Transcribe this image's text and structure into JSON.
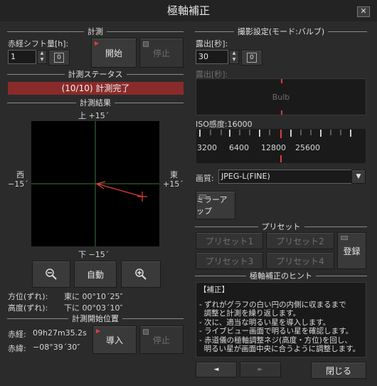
{
  "window": {
    "title": "極軸補正",
    "close": "✕"
  },
  "measure": {
    "section": "計測",
    "shift_label": "赤経シフト量[h]:",
    "shift_value": "1",
    "zero_button": "0",
    "start_button": "開始",
    "stop_button": "停止"
  },
  "status": {
    "section": "計測ステータス",
    "text": "(10/10) 計測完了"
  },
  "result": {
    "section": "計測結果",
    "north": "上 +15´",
    "south": "下 −15´",
    "west_name": "西",
    "west_value": "−15´",
    "east_name": "東",
    "east_value": "+15´",
    "zoom_out": "zoom-out",
    "auto": "自動",
    "zoom_in": "zoom-in",
    "azimuth_label": "方位(ずれ):",
    "azimuth_value": "東に 00°10´25″",
    "altitude_label": "高度(ずれ):",
    "altitude_value": "下に 00°03´10″"
  },
  "start_position": {
    "section": "計測開始位置",
    "ra_label": "赤経:",
    "ra_value": "09h27m35.2s",
    "dec_label": "赤緯:",
    "dec_value": "−08°39´30″",
    "import_button": "導入",
    "stop_button": "停止"
  },
  "capture": {
    "section": "撮影設定(モード:バルブ)",
    "exposure_label": "露出[秒]:",
    "exposure_value": "30",
    "zero_button": "0",
    "exposure_label2": "露出[秒]:",
    "bulb_text": "Bulb",
    "iso_label": "ISO感度:16000",
    "iso_ticks": [
      "3200",
      "6400",
      "12800",
      "25600"
    ],
    "quality_label": "画質:",
    "quality_value": "JPEG-L(FINE)",
    "mirror_button": "ミラーアップ"
  },
  "preset": {
    "section": "プリセット",
    "p1": "プリセット1",
    "p2": "プリセット2",
    "p3": "プリセット3",
    "p4": "プリセット4",
    "register": "登録"
  },
  "hint": {
    "section": "極軸補正のヒント",
    "heading": "【補正】",
    "lines": [
      "- ずれがグラフの白い円の内側に収まるまで",
      "  調整と計測を繰り返します。",
      "- 次に、適当な明るい星を導入します。",
      "- ライブビュー画面で明るい星を確認します。",
      "- 赤道儀の極軸調整ネジ(高度・方位)を回し、",
      "  明るい星が画面中央に合うように調整します。"
    ],
    "prev": "◄",
    "next": "►",
    "close": "閉じる"
  },
  "colors": {
    "accent_red": "#e23c3c",
    "status_bg": "#8a2b2b",
    "axis_green": "#3a7a3a"
  }
}
